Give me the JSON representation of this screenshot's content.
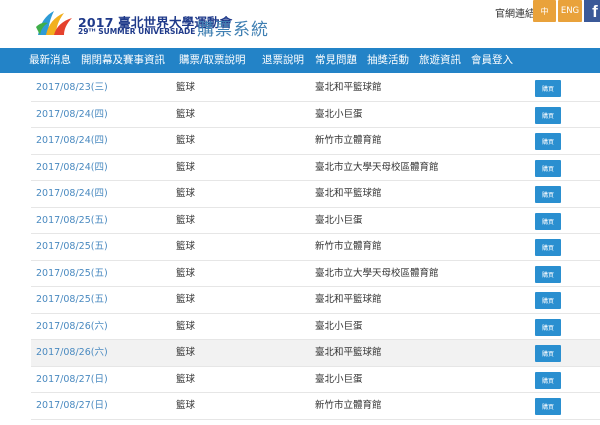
{
  "header": {
    "logo_title": "2017 臺北世界大學運動會",
    "logo_sub": "29ᵀᴴ SUMMER UNIVERSIADE",
    "system_title": "購票系統",
    "official_link": "官網連結",
    "lang_zh": "中",
    "lang_eng": "ENG",
    "fb_label": "f"
  },
  "nav": {
    "items": [
      "最新消息",
      "開閉幕及賽事資訊",
      "購票/取票說明",
      "退票說明",
      "常見問題",
      "抽獎活動",
      "旅遊資訊",
      "會員登入"
    ]
  },
  "table": {
    "buy_label": "購買",
    "rows": [
      {
        "date": "2017/08/23(三)",
        "sport": "籃球",
        "venue": "臺北和平籃球館"
      },
      {
        "date": "2017/08/24(四)",
        "sport": "籃球",
        "venue": "臺北小巨蛋"
      },
      {
        "date": "2017/08/24(四)",
        "sport": "籃球",
        "venue": "新竹市立體育館"
      },
      {
        "date": "2017/08/24(四)",
        "sport": "籃球",
        "venue": "臺北市立大學天母校區體育館"
      },
      {
        "date": "2017/08/24(四)",
        "sport": "籃球",
        "venue": "臺北和平籃球館"
      },
      {
        "date": "2017/08/25(五)",
        "sport": "籃球",
        "venue": "臺北小巨蛋"
      },
      {
        "date": "2017/08/25(五)",
        "sport": "籃球",
        "venue": "新竹市立體育館"
      },
      {
        "date": "2017/08/25(五)",
        "sport": "籃球",
        "venue": "臺北市立大學天母校區體育館"
      },
      {
        "date": "2017/08/25(五)",
        "sport": "籃球",
        "venue": "臺北和平籃球館"
      },
      {
        "date": "2017/08/26(六)",
        "sport": "籃球",
        "venue": "臺北小巨蛋"
      },
      {
        "date": "2017/08/26(六)",
        "sport": "籃球",
        "venue": "臺北和平籃球館"
      },
      {
        "date": "2017/08/27(日)",
        "sport": "籃球",
        "venue": "臺北小巨蛋"
      },
      {
        "date": "2017/08/27(日)",
        "sport": "籃球",
        "venue": "新竹市立體育館"
      }
    ]
  },
  "colors": {
    "nav_bg": "#2383c7",
    "brand_blue": "#1f3a8a",
    "lang_button": "#e9a23b",
    "facebook": "#3b5998",
    "buy_button": "#2a8fd0",
    "date_text": "#4a8ac0"
  },
  "icons": {
    "logo": "universiade-logo-icon",
    "facebook": "facebook-icon"
  }
}
